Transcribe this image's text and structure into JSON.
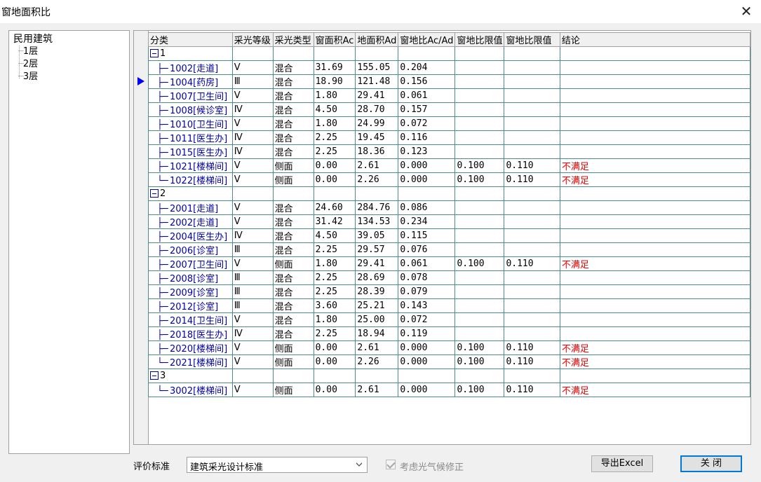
{
  "window": {
    "title": "窗地面积比",
    "close_glyph": "✕"
  },
  "tree": {
    "root": "民用建筑",
    "items": [
      {
        "label": "1层"
      },
      {
        "label": "2层"
      },
      {
        "label": "3层"
      }
    ]
  },
  "grid": {
    "columns": [
      "分类",
      "采光等级",
      "采光类型",
      "窗面积Ac",
      "地面积Ad",
      "窗地比Ac/Ad",
      "窗地比限值",
      "窗地比限值",
      "结论"
    ],
    "groups": [
      {
        "label": "1",
        "rows": [
          [
            "1002[走道]",
            "Ⅴ",
            "混合",
            "31.69",
            "155.05",
            "0.204",
            "",
            "",
            ""
          ],
          [
            "1004[药房]",
            "Ⅲ",
            "混合",
            "18.90",
            "121.48",
            "0.156",
            "",
            "",
            ""
          ],
          [
            "1007[卫生间]",
            "Ⅴ",
            "混合",
            "1.80",
            "29.41",
            "0.061",
            "",
            "",
            ""
          ],
          [
            "1008[候诊室]",
            "Ⅳ",
            "混合",
            "4.50",
            "28.70",
            "0.157",
            "",
            "",
            ""
          ],
          [
            "1010[卫生间]",
            "Ⅴ",
            "混合",
            "1.80",
            "24.99",
            "0.072",
            "",
            "",
            ""
          ],
          [
            "1011[医生办]",
            "Ⅳ",
            "混合",
            "2.25",
            "19.45",
            "0.116",
            "",
            "",
            ""
          ],
          [
            "1015[医生办]",
            "Ⅳ",
            "混合",
            "2.25",
            "18.36",
            "0.123",
            "",
            "",
            ""
          ],
          [
            "1021[楼梯间]",
            "Ⅴ",
            "侧面",
            "0.00",
            "2.61",
            "0.000",
            "0.100",
            "0.110",
            "不满足"
          ],
          [
            "1022[楼梯间]",
            "Ⅴ",
            "侧面",
            "0.00",
            "2.26",
            "0.000",
            "0.100",
            "0.110",
            "不满足"
          ]
        ]
      },
      {
        "label": "2",
        "rows": [
          [
            "2001[走道]",
            "Ⅴ",
            "混合",
            "24.60",
            "284.76",
            "0.086",
            "",
            "",
            ""
          ],
          [
            "2002[走道]",
            "Ⅴ",
            "混合",
            "31.42",
            "134.53",
            "0.234",
            "",
            "",
            ""
          ],
          [
            "2004[医生办]",
            "Ⅳ",
            "混合",
            "4.50",
            "39.05",
            "0.115",
            "",
            "",
            ""
          ],
          [
            "2006[诊室]",
            "Ⅲ",
            "混合",
            "2.25",
            "29.57",
            "0.076",
            "",
            "",
            ""
          ],
          [
            "2007[卫生间]",
            "Ⅴ",
            "侧面",
            "1.80",
            "29.41",
            "0.061",
            "0.100",
            "0.110",
            "不满足"
          ],
          [
            "2008[诊室]",
            "Ⅲ",
            "混合",
            "2.25",
            "28.69",
            "0.078",
            "",
            "",
            ""
          ],
          [
            "2009[诊室]",
            "Ⅲ",
            "混合",
            "2.25",
            "28.39",
            "0.079",
            "",
            "",
            ""
          ],
          [
            "2012[诊室]",
            "Ⅲ",
            "混合",
            "3.60",
            "25.21",
            "0.143",
            "",
            "",
            ""
          ],
          [
            "2014[卫生间]",
            "Ⅴ",
            "混合",
            "1.80",
            "25.00",
            "0.072",
            "",
            "",
            ""
          ],
          [
            "2018[医生办]",
            "Ⅳ",
            "混合",
            "2.25",
            "18.94",
            "0.119",
            "",
            "",
            ""
          ],
          [
            "2020[楼梯间]",
            "Ⅴ",
            "侧面",
            "0.00",
            "2.61",
            "0.000",
            "0.100",
            "0.110",
            "不满足"
          ],
          [
            "2021[楼梯间]",
            "Ⅴ",
            "侧面",
            "0.00",
            "2.26",
            "0.000",
            "0.100",
            "0.110",
            "不满足"
          ]
        ]
      },
      {
        "label": "3",
        "rows": [
          [
            "3002[楼梯间]",
            "Ⅴ",
            "侧面",
            "0.00",
            "2.61",
            "0.000",
            "0.100",
            "0.110",
            "不满足"
          ]
        ]
      }
    ]
  },
  "footer": {
    "standard_label": "评价标准",
    "standard_value": "建筑采光设计标准",
    "climate_label": "考虑光气候修正",
    "climate_checked": true,
    "export_label": "导出Excel",
    "close_label": "关  闭"
  },
  "colors": {
    "fail_text": "#ff0000",
    "room_text": "#0000aa",
    "selected_arrow": "#0000ff"
  }
}
